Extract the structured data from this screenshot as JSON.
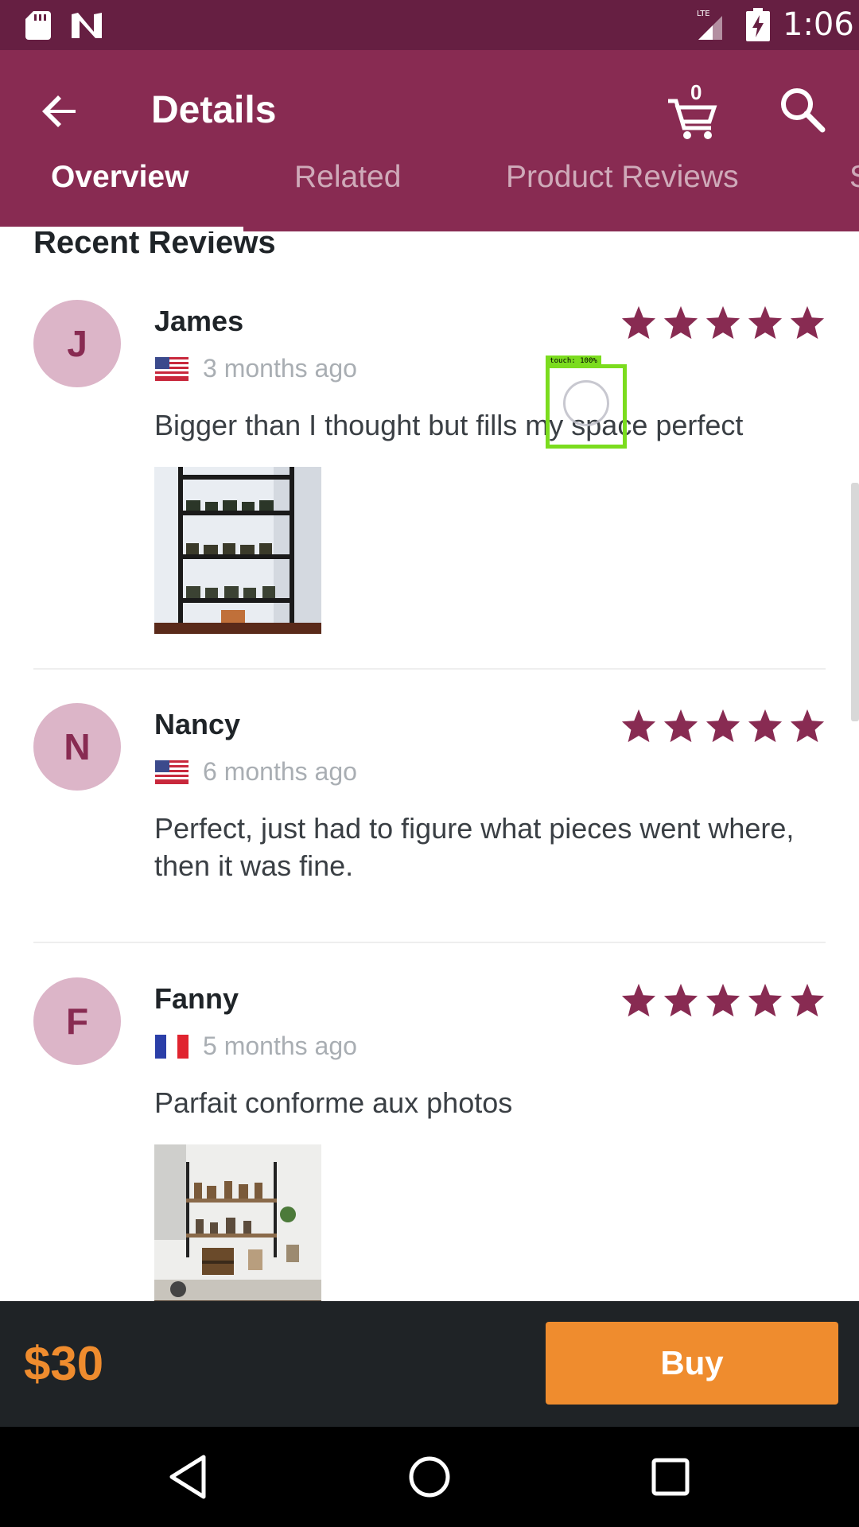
{
  "status_bar": {
    "time": "1:06",
    "network": "LTE",
    "icons": [
      "sd-card-icon",
      "n-notification-icon",
      "lte-signal-icon",
      "battery-charging-icon"
    ]
  },
  "app_bar": {
    "title": "Details",
    "cart_count": "0",
    "icons": [
      "back-arrow-icon",
      "cart-icon",
      "search-icon"
    ]
  },
  "tabs": [
    {
      "label": "Overview",
      "active": true
    },
    {
      "label": "Related",
      "active": false
    },
    {
      "label": "Product Reviews",
      "active": false
    },
    {
      "label": "S",
      "active": false
    }
  ],
  "section": {
    "title": "Recent Reviews"
  },
  "reviews": [
    {
      "initial": "J",
      "name": "James",
      "rating": 5,
      "country_flag": "us-flag-icon",
      "time": "3 months ago",
      "text": "Bigger than I thought but fills my space perfect",
      "has_photo": true
    },
    {
      "initial": "N",
      "name": "Nancy",
      "rating": 5,
      "country_flag": "us-flag-icon",
      "time": "6 months ago",
      "text": "Perfect, just had to figure what pieces went where, then it was fine.",
      "has_photo": false
    },
    {
      "initial": "F",
      "name": "Fanny",
      "rating": 5,
      "country_flag": "fr-flag-icon",
      "time": "5 months ago",
      "text": "Parfait conforme aux photos",
      "has_photo": true
    }
  ],
  "touch_overlay": {
    "label": "touch: 100%"
  },
  "buy_bar": {
    "price": "$30",
    "buy_label": "Buy"
  },
  "colors": {
    "status_bar": "#661f42",
    "app_bar": "#882b52",
    "star": "#882b52",
    "avatar_bg": "#dcb5c8",
    "price": "#ef8c2e",
    "buy_button": "#ef8c2e",
    "bottom_bar": "#1f2326"
  },
  "nav_bar": {
    "icons": [
      "back-triangle-icon",
      "home-circle-icon",
      "recents-square-icon"
    ]
  }
}
